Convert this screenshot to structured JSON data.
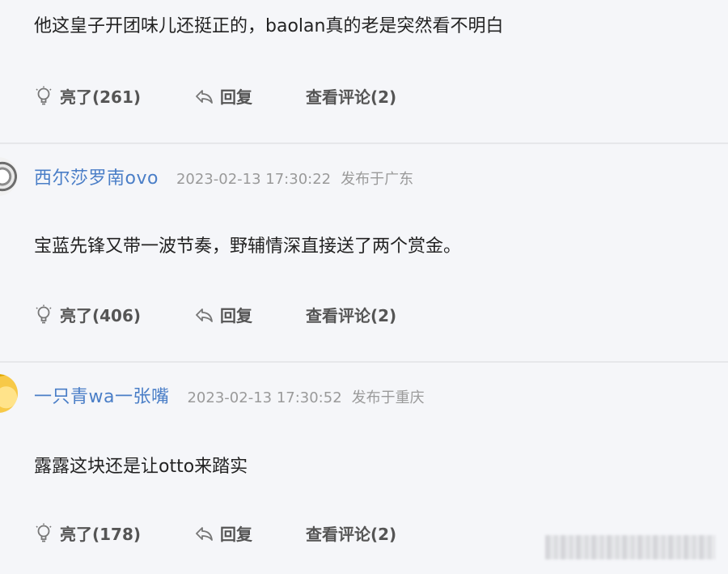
{
  "comments": [
    {
      "content": "他这皇子开团味儿还挺正的，baolan真的老是突然看不明白",
      "like_label": "亮了(261)",
      "reply_label": "回复",
      "view_label": "查看评论(2)"
    },
    {
      "username": "西尔莎罗南ovo",
      "timestamp": "2023-02-13 17:30:22",
      "location": "发布于广东",
      "content": "宝蓝先锋又带一波节奏，野辅情深直接送了两个赏金。",
      "like_label": "亮了(406)",
      "reply_label": "回复",
      "view_label": "查看评论(2)"
    },
    {
      "username": "一只青wa一张嘴",
      "timestamp": "2023-02-13 17:30:52",
      "location": "发布于重庆",
      "content": "露露这块还是让otto来踏实",
      "like_label": "亮了(178)",
      "reply_label": "回复",
      "view_label": "查看评论(2)"
    }
  ],
  "icons": {
    "like": "lightbulb-icon",
    "reply": "reply-arrow-icon"
  },
  "colors": {
    "background": "#f5f6f9",
    "username": "#4a7ec7",
    "meta": "#9a9a9a",
    "divider": "#e6e7ea"
  }
}
